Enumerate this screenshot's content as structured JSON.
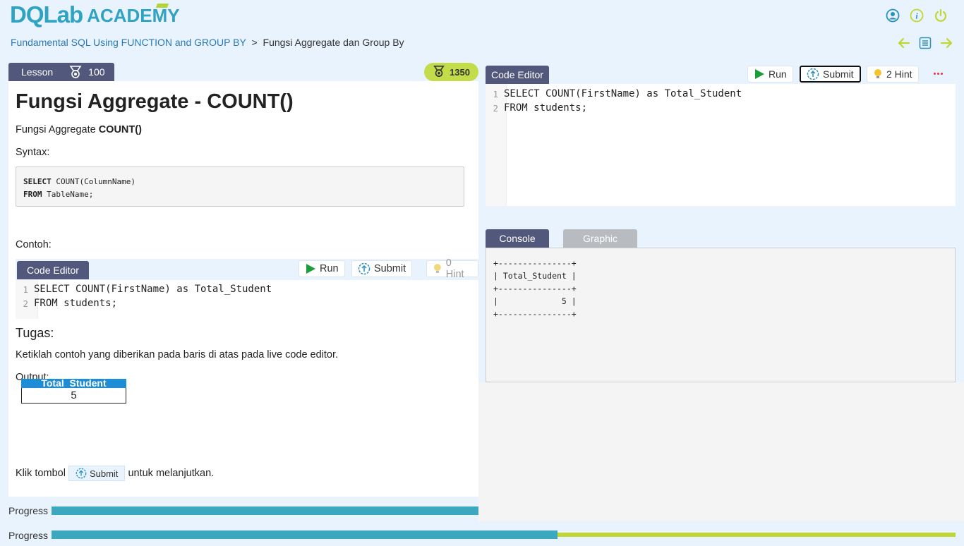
{
  "header": {
    "logo_brand": "DQLab",
    "logo_suffix": "ACADEMY",
    "icons": [
      "user-icon",
      "info-icon",
      "power-icon"
    ]
  },
  "breadcrumb": {
    "course": "Fundamental SQL Using FUNCTION and GROUP BY",
    "separator": ">",
    "current": "Fungsi Aggregate dan Group By"
  },
  "nav": {
    "icons": [
      "arrow-left-icon",
      "list-icon",
      "arrow-right-icon"
    ]
  },
  "lesson": {
    "tab_label": "Lesson",
    "points": "100",
    "xp": "1350",
    "title": "Fungsi Aggregate - COUNT()",
    "subtitle_prefix": "Fungsi Aggregate ",
    "subtitle_bold": "COUNT()",
    "syntax_label": "Syntax:",
    "syntax_lines": [
      {
        "kw": "SELECT",
        "rest": " COUNT(ColumnName)"
      },
      {
        "kw": "FROM",
        "rest": " TableName;"
      }
    ],
    "example_label": "Contoh:",
    "example_editor": {
      "tab": "Code Editor",
      "run": "Run",
      "submit": "Submit",
      "hint": "0 Hint",
      "lines": [
        {
          "n": "1",
          "code": "SELECT COUNT(FirstName) as Total_Student"
        },
        {
          "n": "2",
          "code": "FROM students;"
        }
      ]
    },
    "task_heading": "Tugas:",
    "task_text": "Ketiklah contoh yang diberikan pada baris di atas pada live code editor.",
    "output_label": "Output:",
    "output_table": {
      "header": "Total_Student",
      "value": "5"
    },
    "footer_prefix": "Klik tombol",
    "footer_button": "Submit",
    "footer_suffix": "untuk melanjutkan."
  },
  "editor": {
    "tab": "Code Editor",
    "run": "Run",
    "submit": "Submit",
    "hint": "2 Hint",
    "lines": [
      {
        "n": "1",
        "code": "SELECT COUNT(FirstName) as Total_Student"
      },
      {
        "n": "2",
        "code": "FROM students;"
      }
    ]
  },
  "console": {
    "tabs": [
      "Console",
      "Graphic"
    ],
    "output": "+---------------+\n| Total_Student |\n+---------------+\n|             5 |\n+---------------+"
  },
  "progress": {
    "label": "Progress",
    "lesson_progress": 1.0,
    "course_progress": 0.56,
    "colors": {
      "filled": "#3ba8c0",
      "remaining": "#bfd730"
    }
  }
}
